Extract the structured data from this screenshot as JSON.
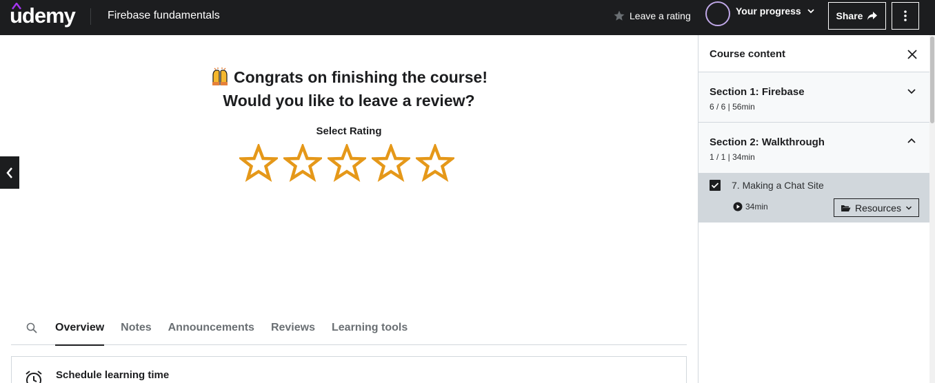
{
  "header": {
    "logo_text": "udemy",
    "course_title": "Firebase fundamentals",
    "leave_rating_label": "Leave a rating",
    "progress_label": "Your progress",
    "share_label": "Share"
  },
  "main": {
    "congrats_line1": "Congrats on finishing the course!",
    "congrats_line2": "Would you like to leave a review?",
    "select_rating_label": "Select Rating",
    "stars": [
      1,
      2,
      3,
      4,
      5
    ],
    "star_color": "#e59819"
  },
  "tabs": {
    "items": [
      "Overview",
      "Notes",
      "Announcements",
      "Reviews",
      "Learning tools"
    ],
    "active": "Overview"
  },
  "schedule": {
    "title": "Schedule learning time"
  },
  "sidebar": {
    "title": "Course content",
    "sections": [
      {
        "title": "Section 1: Firebase",
        "meta": "6 / 6 | 56min",
        "expanded": false
      },
      {
        "title": "Section 2: Walkthrough",
        "meta": "1 / 1 | 34min",
        "expanded": true
      }
    ],
    "lecture": {
      "title": "7. Making a Chat Site",
      "duration": "34min",
      "completed": true,
      "resources_label": "Resources"
    }
  },
  "colors": {
    "header_bg": "#1c1d1f",
    "brand_purple": "#a435f0",
    "section_bg": "#f7f9fa",
    "lecture_active_bg": "#d1d7dc"
  },
  "icons": [
    "udemy-logo",
    "star-icon",
    "chevron-down-icon",
    "share-arrow-icon",
    "more-vertical-icon",
    "chevron-left-icon",
    "raising-hands-emoji",
    "search-icon",
    "alarm-clock-icon",
    "close-icon",
    "chevron-up-icon",
    "checkbox-checked-icon",
    "play-circle-icon",
    "folder-open-icon"
  ]
}
